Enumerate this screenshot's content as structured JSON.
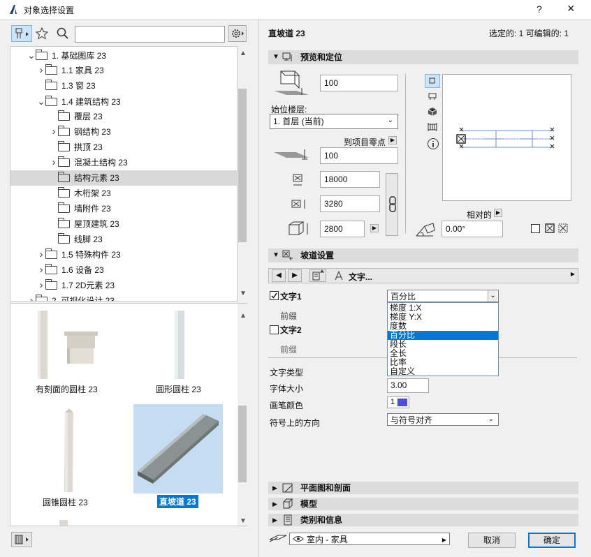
{
  "window": {
    "title": "对象选择设置",
    "help": "?",
    "close": "×"
  },
  "left": {
    "search": {
      "value": "",
      "placeholder": ""
    },
    "tree": [
      {
        "label": "1. 基础图库 23",
        "indent": 1,
        "arrow": "open"
      },
      {
        "label": "1.1 家具 23",
        "indent": 2,
        "arrow": "closed"
      },
      {
        "label": "1.3 窗 23",
        "indent": 2,
        "arrow": "none"
      },
      {
        "label": "1.4 建筑结构 23",
        "indent": 2,
        "arrow": "open"
      },
      {
        "label": "覆层 23",
        "indent": 3,
        "arrow": "none"
      },
      {
        "label": "钢结构 23",
        "indent": 3,
        "arrow": "closed"
      },
      {
        "label": "拱顶 23",
        "indent": 3,
        "arrow": "none"
      },
      {
        "label": "混凝土结构 23",
        "indent": 3,
        "arrow": "closed"
      },
      {
        "label": "结构元素 23",
        "indent": 3,
        "arrow": "none",
        "selected": true
      },
      {
        "label": "木桁架 23",
        "indent": 3,
        "arrow": "none"
      },
      {
        "label": "墙附件 23",
        "indent": 3,
        "arrow": "none"
      },
      {
        "label": "屋顶建筑 23",
        "indent": 3,
        "arrow": "none"
      },
      {
        "label": "线脚 23",
        "indent": 3,
        "arrow": "none"
      },
      {
        "label": "1.5 特殊构件 23",
        "indent": 2,
        "arrow": "closed"
      },
      {
        "label": "1.6 设备 23",
        "indent": 2,
        "arrow": "closed"
      },
      {
        "label": "1.7 2D元素 23",
        "indent": 2,
        "arrow": "closed"
      },
      {
        "label": "2. 可视化设计 23",
        "indent": 1,
        "arrow": "closed"
      }
    ],
    "thumbs": [
      {
        "label": "有刻面的圆柱 23"
      },
      {
        "label": "圆形圆柱 23"
      },
      {
        "label": "圆锥圆柱 23"
      },
      {
        "label": "直坡道 23",
        "selected": true
      }
    ]
  },
  "right": {
    "header": {
      "title": "直坡道 23",
      "status": "选定的: 1 可编辑的: 1"
    },
    "preview_section": "预览和定位",
    "height_value": "100",
    "story_label": "始位楼层:",
    "story_value": "1. 首层 (当前)",
    "project_zero_label": "到项目零点",
    "offset_value": "100",
    "length_value": "18000",
    "width_value": "3280",
    "height2_value": "2800",
    "relative_label": "相对的",
    "angle_value": "0.00°",
    "ramp_section": "坡道设置",
    "text_menu_label": "文字...",
    "text1_label": "文字1",
    "text1_value": "百分比",
    "prefix_label": "前缀",
    "text2_label": "文字2",
    "prefix2_label": "前缀",
    "text_type_label": "文字类型",
    "font_size_label": "字体大小",
    "font_size_value": "3.00",
    "pen_color_label": "画笔颜色",
    "pen_value": "1",
    "direction_label": "符号上的方向",
    "direction_value": "与符号对齐",
    "dropdown_options": [
      "梯度 1:X",
      "梯度 Y:X",
      "度数",
      "百分比",
      "段长",
      "全长",
      "比率",
      "自定义"
    ],
    "dropdown_selected": "百分比",
    "sections": [
      "平面图和剖面",
      "模型",
      "类别和信息"
    ],
    "layer_value": "室内 - 家具",
    "cancel_label": "取消",
    "ok_label": "确定"
  },
  "colors": {
    "accent": "#0078d7",
    "pen": "#4a4de0",
    "selected_thumb": "#c6dcf0"
  }
}
